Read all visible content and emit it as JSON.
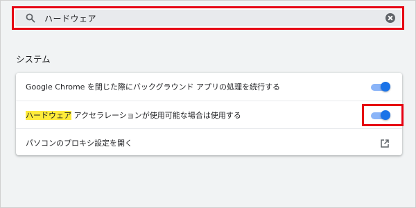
{
  "search": {
    "value": "ハードウェア",
    "highlight_color": "#e60012"
  },
  "section": {
    "title": "システム"
  },
  "settings": [
    {
      "label": "Google Chrome を閉じた際にバックグラウンド アプリの処理を続行する",
      "control": "toggle",
      "enabled": true
    },
    {
      "label_highlight": "ハードウェア",
      "label_rest": " アクセラレーションが使用可能な場合は使用する",
      "control": "toggle",
      "enabled": true
    },
    {
      "label": "パソコンのプロキシ設定を開く",
      "control": "external-link"
    }
  ],
  "icons": {
    "search": "search-icon",
    "clear": "clear-icon",
    "external": "open-in-new-icon"
  },
  "colors": {
    "accent": "#1a73e8",
    "toggle_track": "#8ab4f8",
    "search_highlight": "#ffeb3b"
  }
}
